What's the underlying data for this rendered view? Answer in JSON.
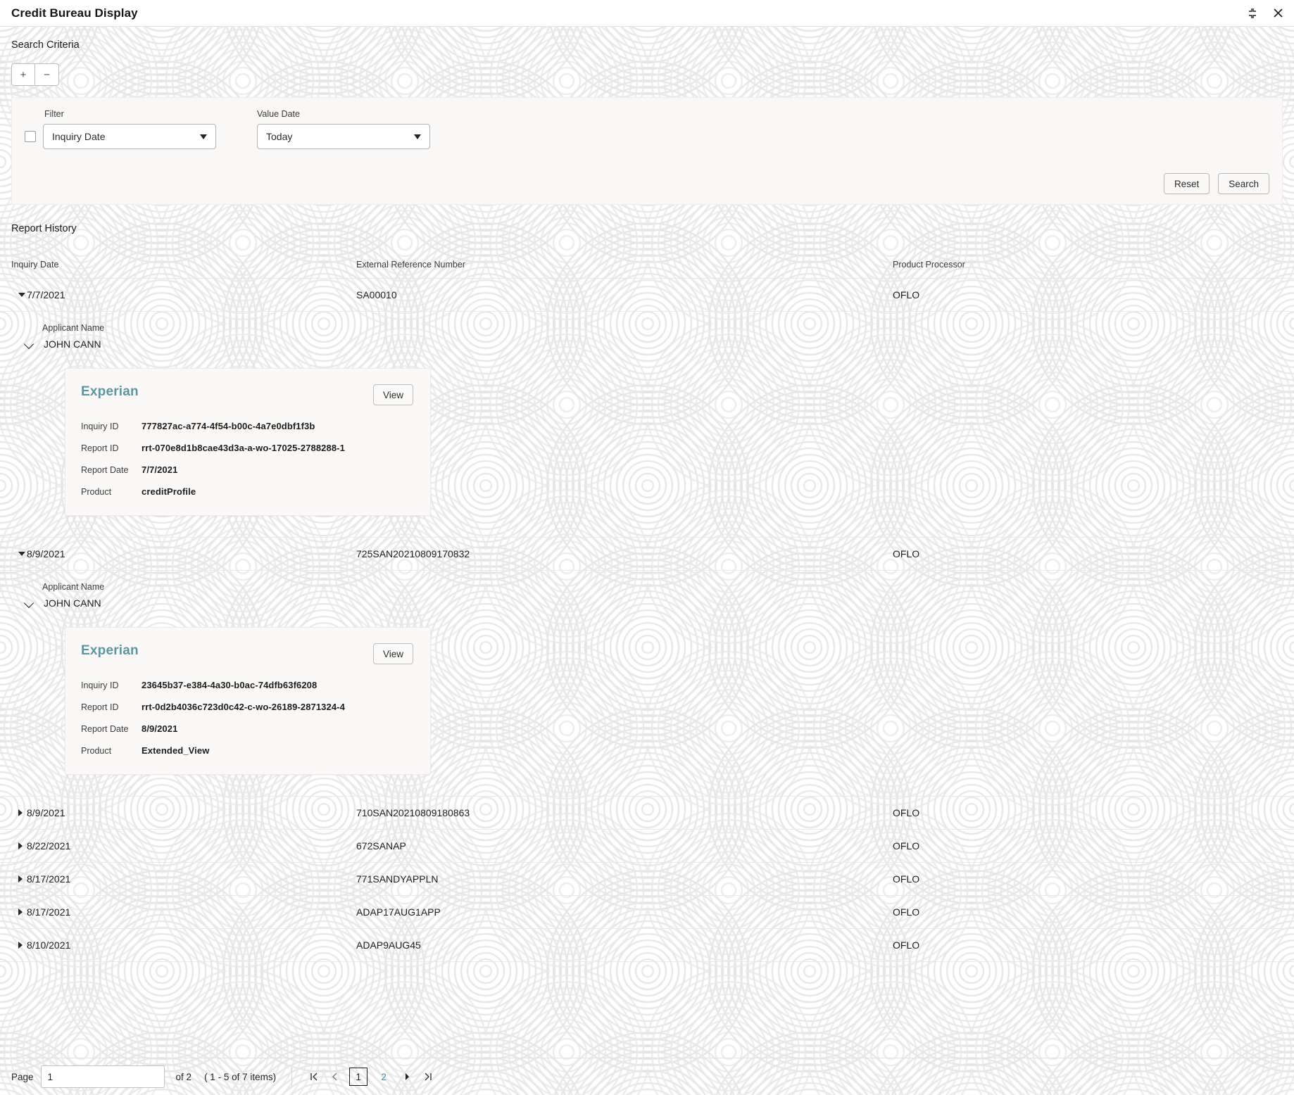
{
  "window": {
    "title": "Credit Bureau Display",
    "minimize_icon": "collapse-icon",
    "close_icon": "close-icon"
  },
  "search": {
    "section_title": "Search Criteria",
    "add_label": "+",
    "remove_label": "−",
    "filter": {
      "label": "Filter",
      "value": "Inquiry Date",
      "checked": false
    },
    "value_date": {
      "label": "Value Date",
      "value": "Today"
    },
    "reset_label": "Reset",
    "search_label": "Search"
  },
  "report_history": {
    "section_title": "Report History",
    "columns": {
      "inquiry_date": "Inquiry Date",
      "external_reference_number": "External Reference Number",
      "product_processor": "Product Processor"
    },
    "applicant_label": "Applicant Name",
    "rows": [
      {
        "inquiry_date": "7/7/2021",
        "external_reference_number": "SA00010",
        "product_processor": "OFLO",
        "expanded": true,
        "applicant_name": "JOHN CANN",
        "card": {
          "bureau": "Experian",
          "view_label": "View",
          "inquiry_id_label": "Inquiry ID",
          "inquiry_id": "777827ac-a774-4f54-b00c-4a7e0dbf1f3b",
          "report_id_label": "Report ID",
          "report_id": "rrt-070e8d1b8cae43d3a-a-wo-17025-2788288-1",
          "report_date_label": "Report Date",
          "report_date": "7/7/2021",
          "product_label": "Product",
          "product": "creditProfile"
        }
      },
      {
        "inquiry_date": "8/9/2021",
        "external_reference_number": "725SAN20210809170832",
        "product_processor": "OFLO",
        "expanded": true,
        "applicant_name": "JOHN CANN",
        "card": {
          "bureau": "Experian",
          "view_label": "View",
          "inquiry_id_label": "Inquiry ID",
          "inquiry_id": "23645b37-e384-4a30-b0ac-74dfb63f6208",
          "report_id_label": "Report ID",
          "report_id": "rrt-0d2b4036c723d0c42-c-wo-26189-2871324-4",
          "report_date_label": "Report Date",
          "report_date": "8/9/2021",
          "product_label": "Product",
          "product": "Extended_View"
        }
      },
      {
        "inquiry_date": "8/9/2021",
        "external_reference_number": "710SAN20210809180863",
        "product_processor": "OFLO",
        "expanded": false
      },
      {
        "inquiry_date": "8/22/2021",
        "external_reference_number": "672SANAP",
        "product_processor": "OFLO",
        "expanded": false
      },
      {
        "inquiry_date": "8/17/2021",
        "external_reference_number": "771SANDYAPPLN",
        "product_processor": "OFLO",
        "expanded": false
      },
      {
        "inquiry_date": "8/17/2021",
        "external_reference_number": "ADAP17AUG1APP",
        "product_processor": "OFLO",
        "expanded": false
      },
      {
        "inquiry_date": "8/10/2021",
        "external_reference_number": "ADAP9AUG45",
        "product_processor": "OFLO",
        "expanded": false
      }
    ]
  },
  "pagination": {
    "page_label": "Page",
    "page_value": "1",
    "of_text": "of 2",
    "items_text": "( 1 - 5 of 7 items)",
    "first_icon": "first-page-icon",
    "prev_icon": "previous-page-icon",
    "next_icon": "next-page-icon",
    "last_icon": "last-page-icon",
    "pages": [
      "1",
      "2"
    ],
    "active_page": "1"
  },
  "colors": {
    "accent": "#5f94a3",
    "link": "#4a8f9e",
    "panel_bg": "#f9f8f7"
  }
}
